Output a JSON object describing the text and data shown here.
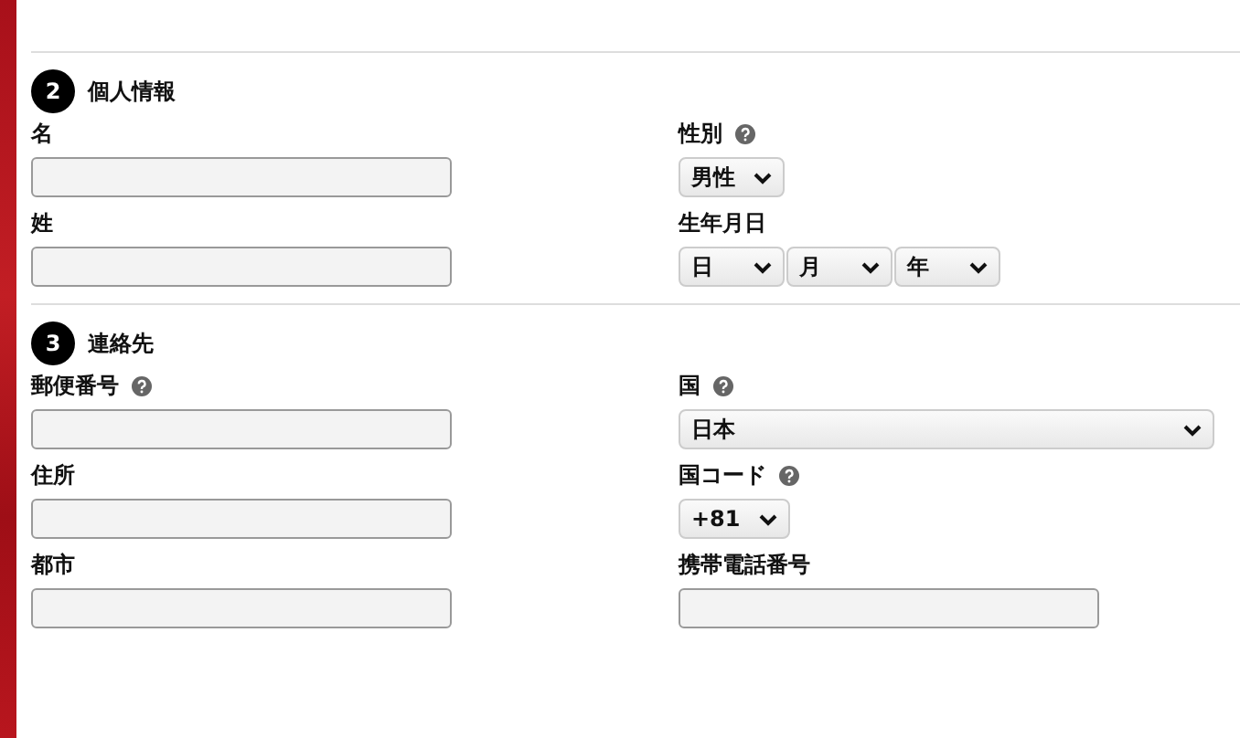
{
  "sections": [
    {
      "number": "2",
      "title": "個人情報",
      "left": [
        {
          "label": "名",
          "kind": "text"
        },
        {
          "label": "姓",
          "kind": "text"
        }
      ],
      "right": [
        {
          "label": "性別",
          "help": true,
          "kind": "select",
          "options": [
            "男性"
          ]
        },
        {
          "label": "生年月日",
          "kind": "select",
          "options": [
            "日",
            "月",
            "年"
          ]
        }
      ]
    },
    {
      "number": "3",
      "title": "連絡先",
      "left": [
        {
          "label": "郵便番号",
          "help": true,
          "kind": "text"
        },
        {
          "label": "住所",
          "kind": "text"
        },
        {
          "label": "都市",
          "kind": "text"
        }
      ],
      "right": [
        {
          "label": "国",
          "help": true,
          "kind": "wide-select",
          "options": [
            "日本"
          ]
        },
        {
          "label": "国コード",
          "help": true,
          "kind": "select",
          "options": [
            "+81"
          ]
        },
        {
          "label": "携帯電話番号",
          "kind": "text"
        }
      ]
    }
  ]
}
